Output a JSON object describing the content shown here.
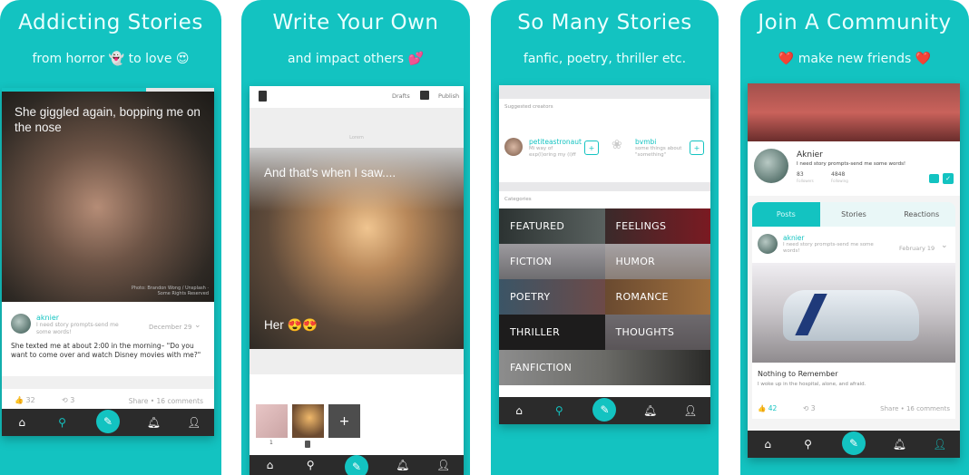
{
  "panels": [
    {
      "headline": "Addicting Stories",
      "subhead": "from horror 👻 to love 😍",
      "story": {
        "overlay_text": "She giggled again, bopping me on the nose",
        "credit": "Photo: Brandon Wong / Unsplash · Some Rights Reserved",
        "author": "aknier",
        "author_bio": "I need story prompts-send me some words!",
        "date": "December 29",
        "body": "She texted me at about 2:00 in the morning– \"Do you want to come over and watch Disney movies with me?\"",
        "likes": "32",
        "reposts": "3",
        "share": "Share • 16 comments"
      }
    },
    {
      "headline": "Write Your Own",
      "subhead": "and impact others 💕",
      "editor": {
        "drafts_label": "Drafts",
        "publish_label": "Publish",
        "title_placeholder": "Lorem",
        "line1": "And that's when I saw....",
        "line2": "Her 😍😍",
        "page_number": "1",
        "add_label": "+"
      }
    },
    {
      "headline": "So Many Stories",
      "subhead": "fanfic, poetry, thriller etc.",
      "discover": {
        "suggested_label": "Suggested creators",
        "creators": [
          {
            "name": "petiteastronaut",
            "bio": "Mi way of exp(l)oring my (i)ff",
            "follow": "+"
          },
          {
            "name": "bvmbi",
            "bio": "some things about \"something\"",
            "follow": "+"
          }
        ],
        "categories_label": "Categories",
        "categories": [
          "FEATURED",
          "FEELINGS",
          "FICTION",
          "HUMOR",
          "POETRY",
          "ROMANCE",
          "THRILLER",
          "THOUGHTS",
          "FANFICTION"
        ]
      }
    },
    {
      "headline": "Join A Community",
      "subhead": "❤️ make new friends ❤️",
      "profile": {
        "name": "Aknier",
        "bio": "I need story prompts-send me some words!",
        "followers_count": "83",
        "followers_label": "Followers",
        "following_count": "4848",
        "following_label": "Following",
        "tabs": [
          "Posts",
          "Stories",
          "Reactions"
        ],
        "post_author": "aknier",
        "post_bio": "I need story prompts-send me some words!",
        "post_date": "February 19",
        "post_title": "Nothing to Remember",
        "post_excerpt": "I woke up in the hospital, alone, and afraid.",
        "likes": "42",
        "reposts": "3",
        "share": "Share • 16 comments"
      }
    }
  ],
  "colors": {
    "accent": "#13c3c1",
    "navbar": "#2b2b2b"
  },
  "nav_icons": [
    "home-icon",
    "search-icon",
    "compose-icon",
    "bell-icon",
    "profile-icon"
  ]
}
